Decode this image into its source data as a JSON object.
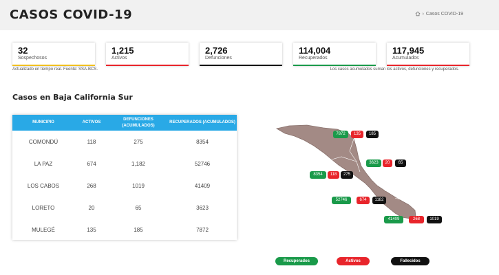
{
  "header": {
    "title": "CASOS COVID-19",
    "breadcrumb": {
      "separator": "›",
      "current": "Casos COVID-19"
    }
  },
  "cards": [
    {
      "value": "32",
      "label": "Sospechosos",
      "color": "#f2c01e"
    },
    {
      "value": "1,215",
      "label": "Activos",
      "color": "#e8252b"
    },
    {
      "value": "2,726",
      "label": "Defunciones",
      "color": "#111111"
    },
    {
      "value": "114,004",
      "label": "Recuperados",
      "color": "#1a9a4a"
    },
    {
      "value": "117,945",
      "label": "Acumulados",
      "color": "#e8252b"
    }
  ],
  "notes": {
    "left": "Actualizado en tiempo real. Fuente: SSA-BCS.",
    "right": "Los casos acumulados suman los activos, defunciones y recuperados."
  },
  "section_title": "Casos en Baja California Sur",
  "table": {
    "headers": [
      "MUNICIPIO",
      "ACTIVOS",
      "DEFUNCIONES (ACUMULADOS)",
      "RECUPERADOS (ACUMULADOS)"
    ],
    "rows": [
      [
        "COMONDÚ",
        "118",
        "275",
        "8354"
      ],
      [
        "LA PAZ",
        "674",
        "1,182",
        "52746"
      ],
      [
        "LOS CABOS",
        "268",
        "1019",
        "41409"
      ],
      [
        "LORETO",
        "20",
        "65",
        "3623"
      ],
      [
        "MULEGÉ",
        "135",
        "185",
        "7872"
      ]
    ]
  },
  "map": {
    "land_color": "#a38a85",
    "labels": {
      "mulege": [
        "7872",
        "135",
        "185"
      ],
      "loreto": [
        "3623",
        "20",
        "65"
      ],
      "comondu": [
        "8354",
        "118",
        "275"
      ],
      "lapaz": [
        "52746",
        "674",
        "1182"
      ],
      "loscabos": [
        "41409",
        "268",
        "1019"
      ]
    }
  },
  "legend": {
    "recuperados": "Recuperados",
    "activos": "Activos",
    "fallecidos": "Fallecidos"
  },
  "colors": {
    "table_header": "#29a9e6",
    "recovered": "#1a9a4a",
    "active": "#e8252b",
    "deaths": "#111111"
  }
}
